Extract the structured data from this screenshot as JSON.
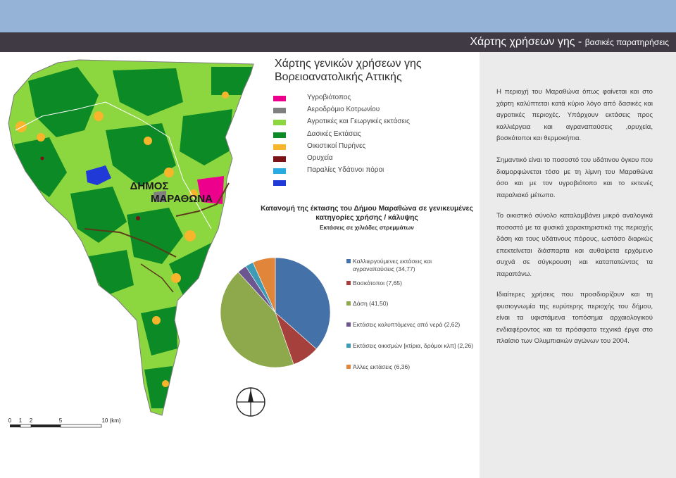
{
  "header": {
    "title_main": "Χάρτης χρήσεων γης - ",
    "title_sub": "βασικές παρατηρήσεις"
  },
  "map": {
    "title_line1": "Χάρτης γενικών χρήσεων γης",
    "title_line2": "Βορειοανατολικής Αττικής",
    "region_label_line1": "ΔΗΜΟΣ",
    "region_label_line2": "ΜΑΡΑΘΩΝΑ",
    "scale": {
      "ticks": [
        "0",
        "1",
        "2",
        "5",
        "10 (km)"
      ]
    },
    "legend": [
      {
        "label": "Υγροβιότοπος",
        "color": "#ec008c"
      },
      {
        "label": "Αεροδρόμιο Κοτρωνίου",
        "color": "#808080"
      },
      {
        "label": "Αγροτικές και Γεωργικές εκτάσεις",
        "color": "#8cd63f"
      },
      {
        "label": "Δασικές Εκτάσεις",
        "color": "#0b8a26"
      },
      {
        "label": "Οικιστικοί Πυρήνες",
        "color": "#f7b52c"
      },
      {
        "label": "Ορυχεία",
        "color": "#7a1216"
      },
      {
        "label": "Παραλίες Υδάτινοι πόροι",
        "color": "#29abe2"
      },
      {
        "label": "",
        "color": "#1f3ad6"
      }
    ],
    "icons": {
      "north_arrow": "compass-icon"
    }
  },
  "pie": {
    "title_line1": "Κατανομή της έκτασης του Δήμου Μαραθώνα σε γενικευμένες",
    "title_line2": "κατηγορίες χρήσης / κάλυψης",
    "subtitle": "Εκτάσεις σε χιλιάδες στρεμμάτων"
  },
  "chart_data": {
    "type": "pie",
    "title": "Κατανομή της έκτασης του Δήμου Μαραθώνα σε γενικευμένες κατηγορίες χρήσης / κάλυψης",
    "subtitle": "Εκτάσεις σε χιλιάδες στρεμμάτων",
    "start": "12 o'clock, clockwise",
    "legend_position": "right",
    "slices": [
      {
        "label": "Καλλιεργούμενες εκτάσεις και αγραναπαύσεις (34,77)",
        "value": 34.77,
        "color": "#4472a8"
      },
      {
        "label": "Βοσκότοποι (7,65)",
        "value": 7.65,
        "color": "#a6403d"
      },
      {
        "label": "Δάση (41,50)",
        "value": 41.5,
        "color": "#8ea84c"
      },
      {
        "label": "Εκτάσεις καλυπτόμενες από νερά (2,62)",
        "value": 2.62,
        "color": "#6b568f"
      },
      {
        "label": "Εκτάσεις οικισμών [κτίρια, δρόμοι κλπ] (2,26)",
        "value": 2.26,
        "color": "#3d9bb5"
      },
      {
        "label": "Άλλες εκτάσεις (6,36)",
        "value": 6.36,
        "color": "#e0853a"
      }
    ]
  },
  "paragraphs": [
    "Η περιοχή του Μαραθώνα όπως φαίνεται και στο χάρτη καλύπτεται κατά κύριο λόγο από δασικές και αγροτικές περιοχές. Υπάρχουν εκτάσεις προς καλλιέργεια και αγραναπαύσεις ,ορυχεία, βοσκότοποι και θερμοκήπια.",
    "Σημαντικό είναι το ποσοστό του υδάτινου όγκου που διαμορφώνεται τόσο με τη λίμνη του Μαραθώνα όσο και με τον υγροβιότοπο και το εκτενές παραλιακό μέτωπο.",
    "Το οικιστικό σύνολο καταλαμβάνει μικρό αναλογικά ποσοστό με τα φυσικά χαρακτηριστικά της περιοχής δάση και τους υδάτινους πόρους, ωστόσο διαρκώς επεκτείνεται διάσπαρτα και αυθαίρετα ερχόμενο συχνά σε σύγκρουση και καταπατώντας τα παραπάνω.",
    "Ιδιαίτερες χρήσεις που προσδιορίζουν και τη φυσιογνωμία της ευρύτερης περιοχής του δήμου, είναι τα υφιστάμενα τοπόσημα αρχαιολογικού ενδιαφέροντος και τα πρόσφατα τεχνικά έργα στο πλαίσιο των Ολυμπιακών αγώνων του 2004."
  ]
}
